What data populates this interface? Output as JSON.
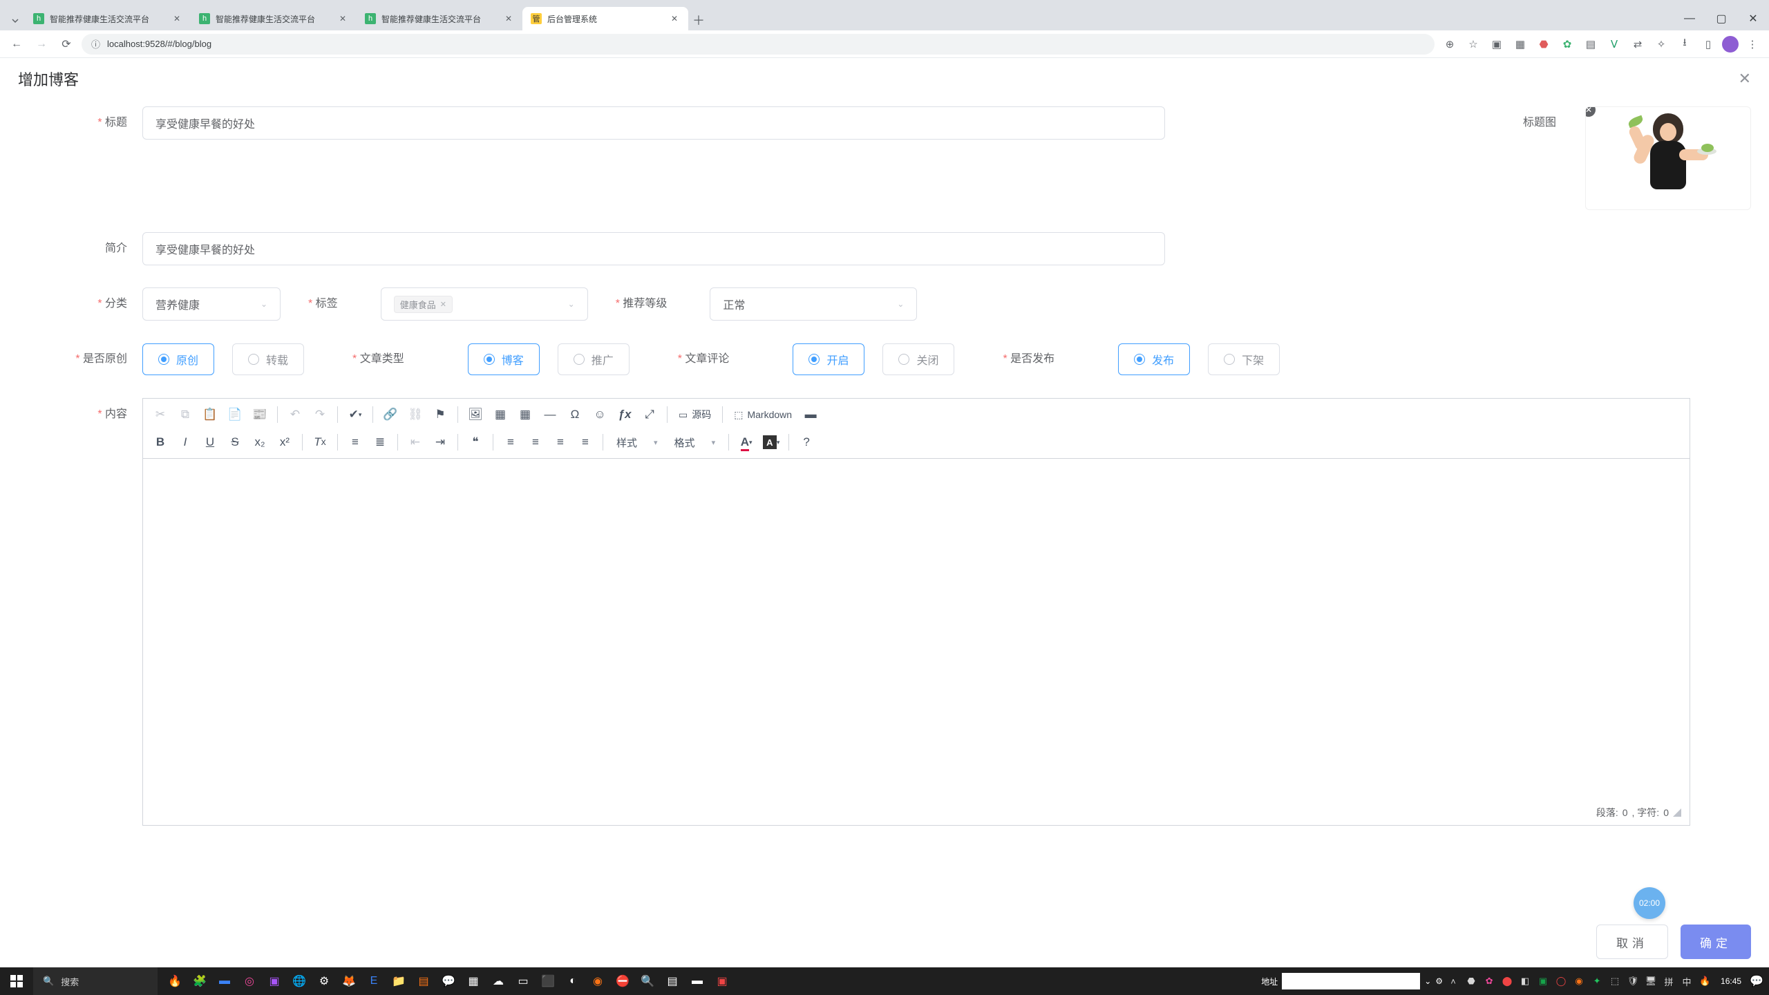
{
  "browser": {
    "tabs": [
      {
        "title": "智能推荐健康生活交流平台",
        "active": false
      },
      {
        "title": "智能推荐健康生活交流平台",
        "active": false
      },
      {
        "title": "智能推荐健康生活交流平台",
        "active": false
      },
      {
        "title": "后台管理系统",
        "active": true
      }
    ],
    "url": "localhost:9528/#/blog/blog"
  },
  "dialog": {
    "title": "增加博客",
    "cancel": "取消",
    "confirm": "确定"
  },
  "form": {
    "title_label": "标题",
    "title_value": "享受健康早餐的好处",
    "intro_label": "简介",
    "intro_value": "享受健康早餐的好处",
    "title_image_label": "标题图",
    "category_label": "分类",
    "category_value": "营养健康",
    "tag_label": "标签",
    "tag_chip": "健康食品",
    "reco_label": "推荐等级",
    "reco_value": "正常",
    "original_label": "是否原创",
    "original_opts": {
      "a": "原创",
      "b": "转载"
    },
    "type_label": "文章类型",
    "type_opts": {
      "a": "博客",
      "b": "推广"
    },
    "comment_label": "文章评论",
    "comment_opts": {
      "a": "开启",
      "b": "关闭"
    },
    "publish_label": "是否发布",
    "publish_opts": {
      "a": "发布",
      "b": "下架"
    },
    "content_label": "内容"
  },
  "editor": {
    "style_combo": "样式",
    "format_combo": "格式",
    "source_btn": "源码",
    "markdown_btn": "Markdown",
    "status_prefix": "段落: ",
    "paragraphs": "0",
    "status_mid": ", 字符: ",
    "chars": "0"
  },
  "timer": "02:00",
  "taskbar": {
    "search_placeholder": "搜索",
    "ime_label": "地址",
    "lang1": "拼",
    "lang2": "中",
    "clock": "16:45"
  }
}
